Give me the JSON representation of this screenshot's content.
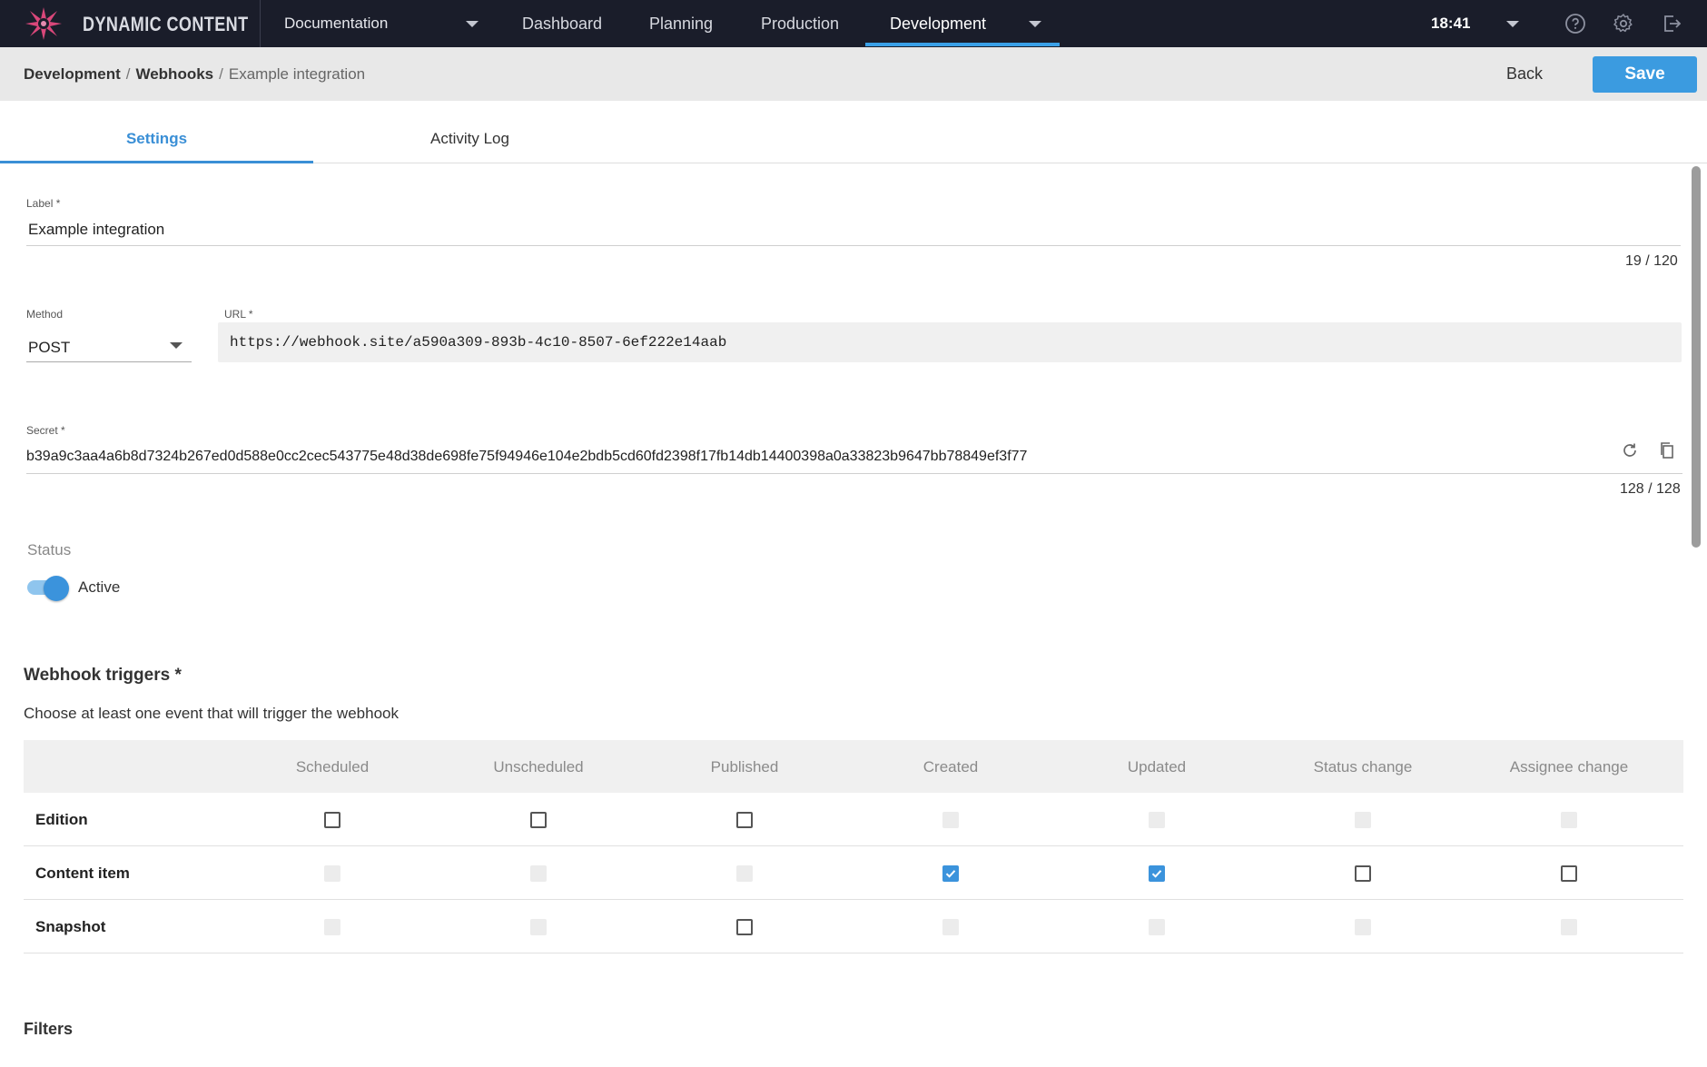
{
  "app": {
    "brand": "DYNAMIC CONTENT",
    "hub": "Documentation",
    "nav": [
      "Dashboard",
      "Planning",
      "Production",
      "Development"
    ],
    "active_nav": "Development",
    "time": "18:41",
    "accent_color": "#3b9be0",
    "icons": [
      "logo-icon",
      "chevron-down-icon",
      "help-icon",
      "gear-icon",
      "logout-icon"
    ]
  },
  "breadcrumb": {
    "level1": "Development",
    "sep1": "/",
    "level2": "Webhooks",
    "sep2": "/",
    "level3": "Example integration"
  },
  "header_actions": {
    "back": "Back",
    "save": "Save"
  },
  "tabs": [
    "Settings",
    "Activity Log"
  ],
  "form": {
    "label": {
      "label": "Label *",
      "value": "Example integration",
      "counter": "19 / 120"
    },
    "method": {
      "label": "Method",
      "value": "POST"
    },
    "url": {
      "label": "URL *",
      "value": "https://webhook.site/a590a309-893b-4c10-8507-6ef222e14aab"
    },
    "secret": {
      "label": "Secret *",
      "value": "b39a9c3aa4a6b8d7324b267ed0d588e0cc2cec543775e48d38de698fe75f94946e104e2bdb5cd60fd2398f17fb14db14400398a0a33823b9647bb78849ef3f77",
      "counter": "128 / 128",
      "icons": [
        "refresh-icon",
        "copy-icon"
      ]
    },
    "status": {
      "label": "Status",
      "toggle_label": "Active",
      "active": true
    }
  },
  "triggers": {
    "title": "Webhook triggers *",
    "description": "Choose at least one event that will trigger the webhook",
    "columns": [
      "Scheduled",
      "Unscheduled",
      "Published",
      "Created",
      "Updated",
      "Status change",
      "Assignee change"
    ],
    "rows": [
      {
        "name": "Edition",
        "states": [
          "empty",
          "empty",
          "empty",
          "disabled",
          "disabled",
          "disabled",
          "disabled"
        ]
      },
      {
        "name": "Content item",
        "states": [
          "disabled",
          "disabled",
          "disabled",
          "checked",
          "checked",
          "empty",
          "empty"
        ]
      },
      {
        "name": "Snapshot",
        "states": [
          "disabled",
          "disabled",
          "empty",
          "disabled",
          "disabled",
          "disabled",
          "disabled"
        ]
      }
    ]
  },
  "filters": {
    "title": "Filters"
  }
}
